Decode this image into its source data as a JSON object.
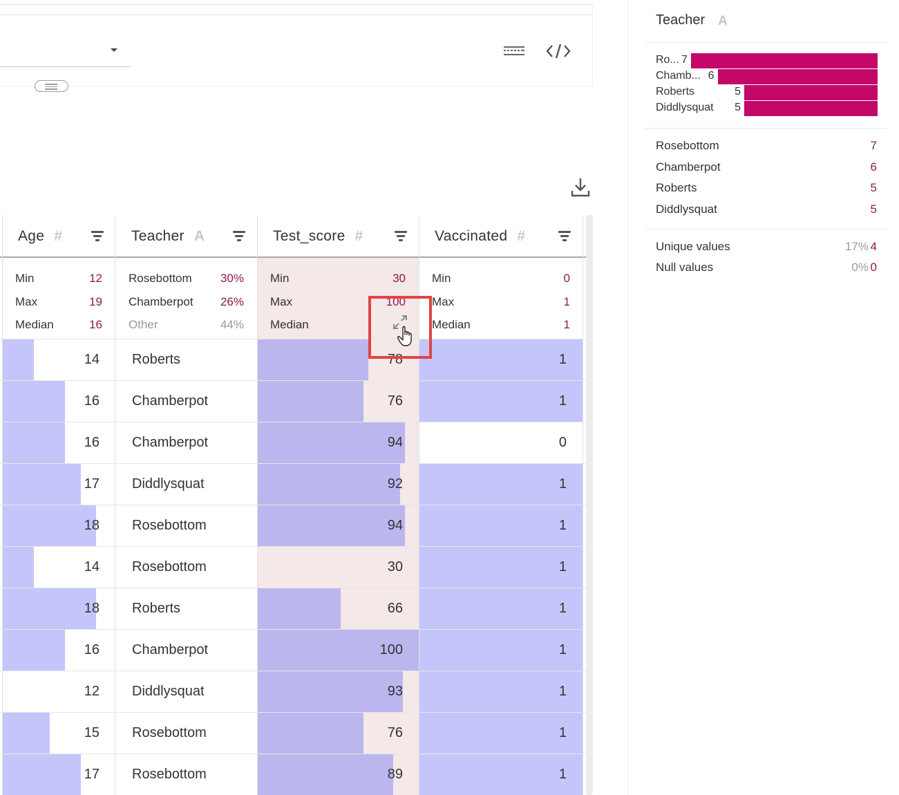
{
  "columns": [
    {
      "name": "Age",
      "type_icon": "#"
    },
    {
      "name": "Teacher",
      "type_icon": "A"
    },
    {
      "name": "Test_score",
      "type_icon": "#"
    },
    {
      "name": "Vaccinated",
      "type_icon": "#"
    }
  ],
  "stats": {
    "age": [
      {
        "label": "Min",
        "value": "12"
      },
      {
        "label": "Max",
        "value": "19"
      },
      {
        "label": "Median",
        "value": "16"
      }
    ],
    "teacher": [
      {
        "label": "Rosebottom",
        "value": "30%"
      },
      {
        "label": "Chamberpot",
        "value": "26%"
      },
      {
        "label": "Other",
        "value": "44%"
      }
    ],
    "test_score": [
      {
        "label": "Min",
        "value": "30"
      },
      {
        "label": "Max",
        "value": "100"
      },
      {
        "label": "Median",
        "value": ""
      }
    ],
    "vaccinated": [
      {
        "label": "Min",
        "value": "0"
      },
      {
        "label": "Max",
        "value": "1"
      },
      {
        "label": "Median",
        "value": "1"
      }
    ]
  },
  "rows": [
    {
      "age": "14",
      "teacher": "Roberts",
      "score": "78",
      "vacc": "1"
    },
    {
      "age": "16",
      "teacher": "Chamberpot",
      "score": "76",
      "vacc": "1"
    },
    {
      "age": "16",
      "teacher": "Chamberpot",
      "score": "94",
      "vacc": "0"
    },
    {
      "age": "17",
      "teacher": "Diddlysquat",
      "score": "92",
      "vacc": "1"
    },
    {
      "age": "18",
      "teacher": "Rosebottom",
      "score": "94",
      "vacc": "1"
    },
    {
      "age": "14",
      "teacher": "Rosebottom",
      "score": "30",
      "vacc": "1"
    },
    {
      "age": "18",
      "teacher": "Roberts",
      "score": "66",
      "vacc": "1"
    },
    {
      "age": "16",
      "teacher": "Chamberpot",
      "score": "100",
      "vacc": "1"
    },
    {
      "age": "12",
      "teacher": "Diddlysquat",
      "score": "93",
      "vacc": "1"
    },
    {
      "age": "15",
      "teacher": "Rosebottom",
      "score": "76",
      "vacc": "1"
    },
    {
      "age": "17",
      "teacher": "Rosebottom",
      "score": "89",
      "vacc": "1"
    }
  ],
  "side": {
    "title": "Teacher",
    "type_icon": "A",
    "mini_chart": [
      {
        "label": "Ro...",
        "value": "7"
      },
      {
        "label": "Chamb...",
        "value": "6"
      },
      {
        "label": "Roberts",
        "value": "5"
      },
      {
        "label": "Diddlysquat",
        "value": "5"
      }
    ],
    "list": [
      {
        "label": "Rosebottom",
        "value": "7"
      },
      {
        "label": "Chamberpot",
        "value": "6"
      },
      {
        "label": "Roberts",
        "value": "5"
      },
      {
        "label": "Diddlysquat",
        "value": "5"
      }
    ],
    "unique_label": "Unique values",
    "unique_pct": "17%",
    "unique_value": "4",
    "null_label": "Null values",
    "null_pct": "0%",
    "null_value": "0"
  },
  "colors": {
    "bar": "#c4c6fb",
    "bar_selected": "#bcb6ee",
    "selected_col_bg": "#f4e8e8",
    "accent": "#c4086a",
    "stat_value": "#8b1a4f"
  },
  "icons": {
    "keyboard": "keyboard-icon",
    "code": "code-icon",
    "download": "download-icon",
    "filter": "filter-icon",
    "expand": "expand-icon",
    "cursor": "hand-cursor-icon"
  }
}
